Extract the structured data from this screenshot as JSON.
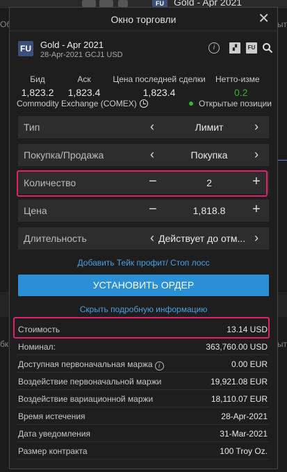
{
  "background": {
    "app_title": "Gold - Apr 2021",
    "badge": "FU",
    "left_text_1": "Обк",
    "right_text_1": "зыт",
    "left_text_2": "бк",
    "right_text_2": "зыт"
  },
  "dialog": {
    "title": "Окно торговли"
  },
  "instrument": {
    "badge": "FU",
    "name": "Gold - Apr 2021",
    "sub": "28-Apr-2021 GCJ1 USD",
    "icons": [
      "info-icon",
      "chart-icon",
      "fu-chart-icon",
      "search-icon"
    ]
  },
  "quotes": {
    "bid_label": "Бид",
    "bid_value": "1,823.2",
    "ask_label": "Аск",
    "ask_value": "1,823.4",
    "last_label": "Цена последней сделки",
    "last_value": "1,823.4",
    "net_label": "Нетто-изме",
    "net_value": "0.2"
  },
  "exchange": {
    "name": "Commodity Exchange (COMEX)",
    "open_positions": "Открытые позиции"
  },
  "order": {
    "type_label": "Тип",
    "type_value": "Лимит",
    "side_label": "Покупка/Продажа",
    "side_value": "Покупка",
    "qty_label": "Количество",
    "qty_value": "2",
    "price_label": "Цена",
    "price_value": "1,818.8",
    "duration_label": "Длительность",
    "duration_value": "Действует до отм..."
  },
  "links": {
    "take_profit": "Добавить Тейк профит/ Стоп лосс",
    "hide_details": "Скрыть подробную информацию"
  },
  "submit_label": "УСТАНОВИТЬ ОРДЕР",
  "details": [
    {
      "label": "Стоимость",
      "value": "13.14 USD"
    },
    {
      "label": "Номинал:",
      "value": "363,760.00 USD"
    },
    {
      "label": "Доступная первоначальная маржа",
      "value": "0.00 EUR"
    },
    {
      "label": "Воздействие первоначальной маржи",
      "value": "19,921.08 EUR"
    },
    {
      "label": "Воздействие вариационной маржи",
      "value": "18,110.07 EUR"
    },
    {
      "label": "Время истечения",
      "value": "28-Apr-2021"
    },
    {
      "label": "Дата уведомления",
      "value": "31-Mar-2021"
    },
    {
      "label": "Размер контракта",
      "value": "100 Troy Oz."
    }
  ],
  "colors": {
    "accent": "#2b8fd6",
    "highlight": "#e0226e",
    "positive": "#38b038"
  }
}
